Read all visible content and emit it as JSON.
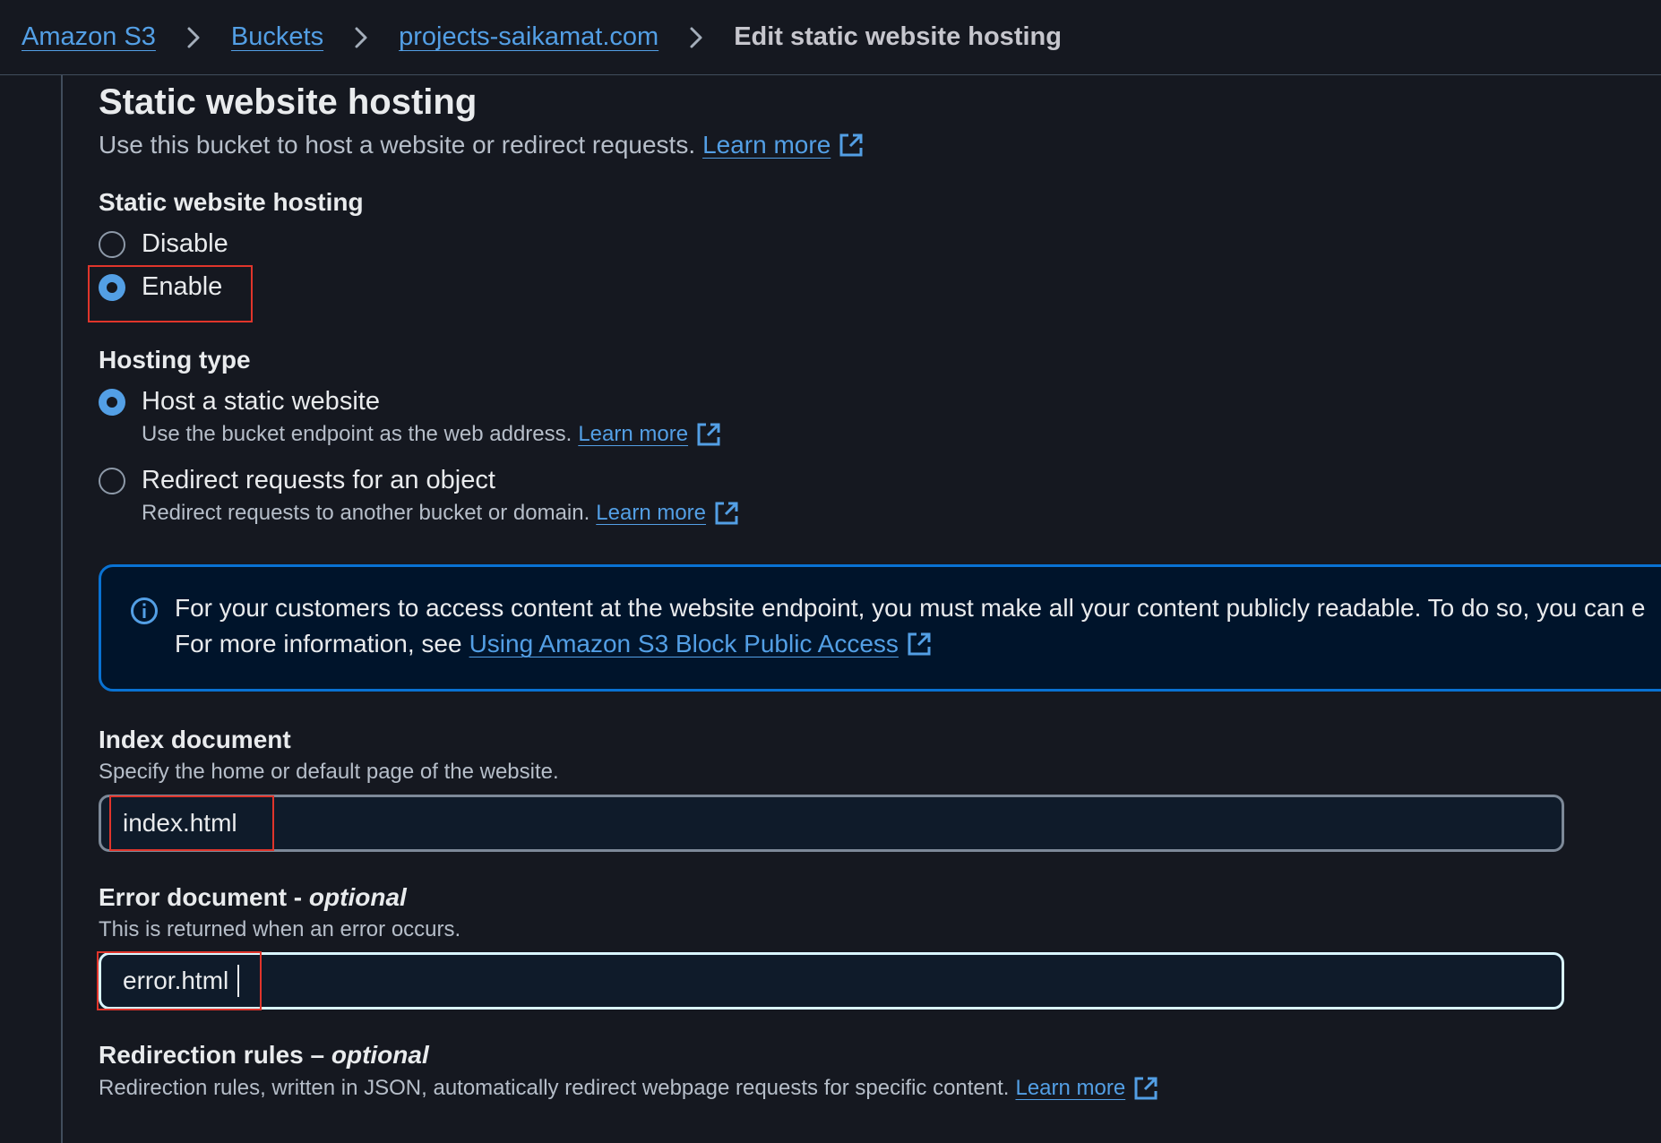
{
  "breadcrumb": {
    "items": [
      "Amazon S3",
      "Buckets",
      "projects-saikamat.com"
    ],
    "current": "Edit static website hosting"
  },
  "section": {
    "title": "Static website hosting",
    "description": "Use this bucket to host a website or redirect requests.",
    "learn_more": "Learn more"
  },
  "hosting": {
    "label": "Static website hosting",
    "options": [
      {
        "label": "Disable",
        "selected": false
      },
      {
        "label": "Enable",
        "selected": true
      }
    ]
  },
  "hosting_type": {
    "label": "Hosting type",
    "options": [
      {
        "label": "Host a static website",
        "description": "Use the bucket endpoint as the web address.",
        "learn_more": "Learn more",
        "selected": true
      },
      {
        "label": "Redirect requests for an object",
        "description": "Redirect requests to another bucket or domain.",
        "learn_more": "Learn more",
        "selected": false
      }
    ]
  },
  "info": {
    "line1": "For your customers to access content at the website endpoint, you must make all your content publicly readable. To do so, you can e",
    "line2_prefix": "For more information, see",
    "link": "Using Amazon S3 Block Public Access"
  },
  "index_document": {
    "label": "Index document",
    "help": "Specify the home or default page of the website.",
    "value": "index.html"
  },
  "error_document": {
    "label": "Error document -",
    "label_optional": "optional",
    "help": "This is returned when an error occurs.",
    "value": "error.html"
  },
  "redirection_rules": {
    "label": "Redirection rules –",
    "label_optional": "optional",
    "help": "Redirection rules, written in JSON, automatically redirect webpage requests for specific content.",
    "learn_more": "Learn more"
  },
  "colors": {
    "background": "#151820",
    "link": "#539fe5",
    "info_border": "#0972d3",
    "highlight": "#e0352b"
  }
}
